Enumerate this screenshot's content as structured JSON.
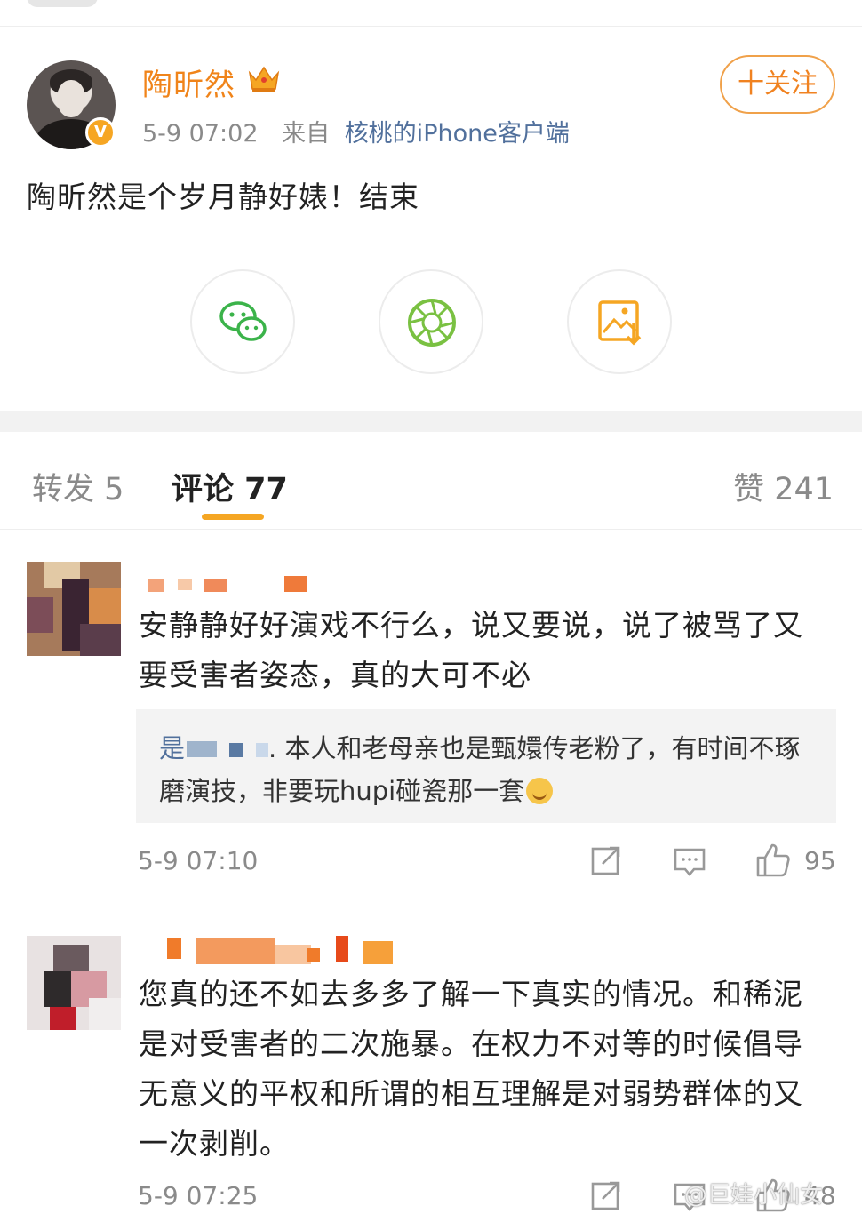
{
  "post": {
    "username": "陶昕然",
    "time": "5-9 07:02",
    "source_label": "来自",
    "source": "核桃的iPhone客户端",
    "follow_label": "十关注",
    "text": "陶昕然是个岁月静好婊！结束",
    "verified_badge": "V"
  },
  "share": {
    "icons": [
      "wechat-icon",
      "moments-icon",
      "save-image-icon"
    ],
    "colors": {
      "wechat": "#3bb34a",
      "moments": "#7ac142",
      "save": "#f5a623"
    }
  },
  "tabs": {
    "repost": "转发 5",
    "comment": "评论 77",
    "like": "赞 241",
    "accent": "#f5a623"
  },
  "comments": [
    {
      "text": "安静静好好演戏不行么，说又要说，说了被骂了又要受害者姿态，真的大可不必",
      "reply_user": "是",
      "reply_text": ". 本人和老母亲也是甄嬛传老粉了，有时间不琢磨演技，非要玩hupi碰瓷那一套",
      "time": "5-9 07:10",
      "likes": "95"
    },
    {
      "text": "您真的还不如去多多了解一下真实的情况。和稀泥是对受害者的二次施暴。在权力不对等的时候倡导无意义的平权和所谓的相互理解是对弱势群体的又一次剥削。",
      "time": "5-9 07:25",
      "likes": "48"
    }
  ],
  "watermark": "@巨娃小仙女"
}
